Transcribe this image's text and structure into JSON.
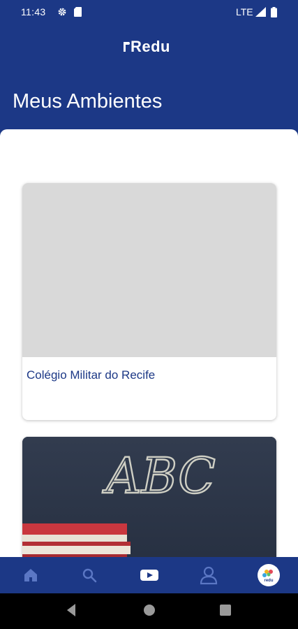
{
  "status_bar": {
    "time": "11:43",
    "network": "LTE"
  },
  "header": {
    "logo_text": "Redu",
    "title": "Meus Ambientes"
  },
  "environments": [
    {
      "name": "Colégio Militar do Recife"
    },
    {
      "image_text": "ABC"
    }
  ],
  "bottom_nav": {
    "items": [
      "home-icon",
      "search-icon",
      "video-icon",
      "profile-icon",
      "redu-avatar-icon"
    ]
  },
  "colors": {
    "primary": "#1c3886",
    "card_placeholder": "#d9d9d9",
    "chalkboard": "#2b3546"
  }
}
